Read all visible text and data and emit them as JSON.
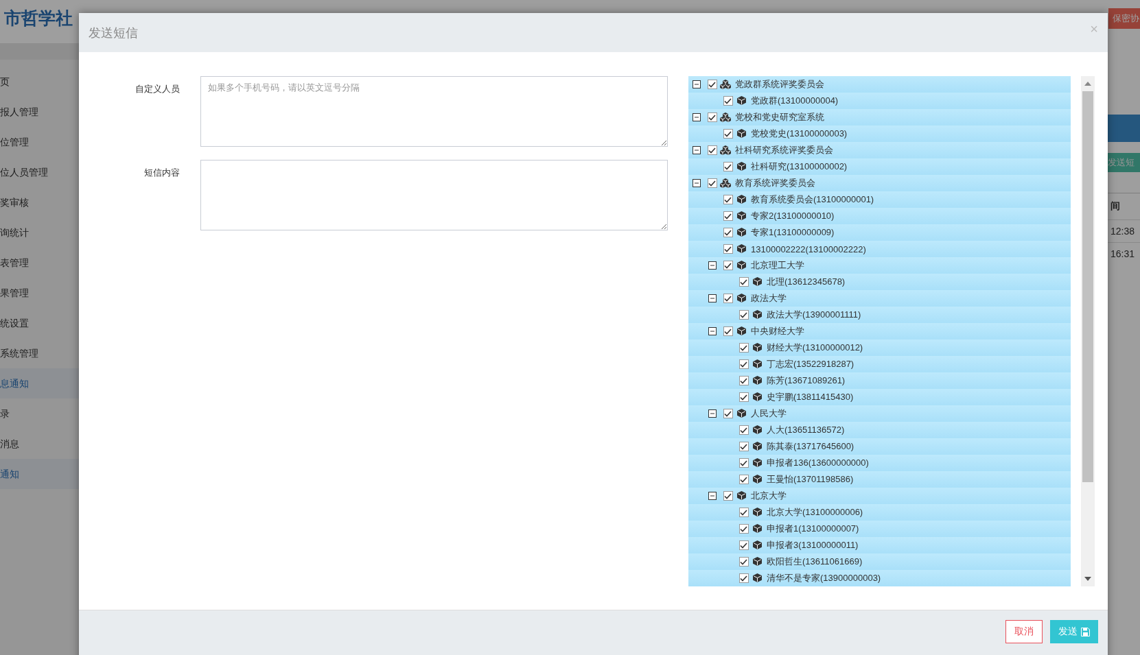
{
  "background_page": {
    "site_title": "市哲学社",
    "sidebar": {
      "items": [
        {
          "label": "页",
          "selected": false
        },
        {
          "label": "报人管理",
          "selected": false
        },
        {
          "label": "位管理",
          "selected": false
        },
        {
          "label": "位人员管理",
          "selected": false
        },
        {
          "label": "奖审核",
          "selected": false
        },
        {
          "label": "询统计",
          "selected": false
        },
        {
          "label": "表管理",
          "selected": false
        },
        {
          "label": "果管理",
          "selected": false
        },
        {
          "label": "统设置",
          "selected": false
        },
        {
          "label": "系统管理",
          "selected": false
        },
        {
          "label": "息通知",
          "selected": true
        },
        {
          "label": "录",
          "selected": false
        },
        {
          "label": "消息",
          "selected": false
        },
        {
          "label": "通知",
          "selected": true
        }
      ]
    },
    "top_button": "保密协",
    "send_button": "发送短",
    "table": {
      "column_1": "间",
      "rows": [
        "12:38",
        "16:31"
      ]
    }
  },
  "dialog": {
    "title": "发送短信",
    "close": "×",
    "fields": [
      {
        "label": "自定义人员",
        "placeholder": "如果多个手机号码，请以英文逗号分隔"
      },
      {
        "label": "短信内容"
      }
    ],
    "tree": [
      {
        "label": "党政群系统评奖委员会",
        "checked": true,
        "expanded": true,
        "children": [
          {
            "label": "党政群(13100000004)",
            "checked": true
          }
        ]
      },
      {
        "label": "党校和党史研究室系统",
        "checked": true,
        "expanded": true,
        "children": [
          {
            "label": "党校党史(13100000003)",
            "checked": true
          }
        ]
      },
      {
        "label": "社科研究系统评奖委员会",
        "checked": true,
        "expanded": true,
        "children": [
          {
            "label": "社科研究(13100000002)",
            "checked": true
          }
        ]
      },
      {
        "label": "教育系统评奖委员会",
        "checked": true,
        "expanded": true,
        "children": [
          {
            "label": "教育系统委员会(13100000001)",
            "checked": true
          },
          {
            "label": "专家2(13100000010)",
            "checked": true
          },
          {
            "label": "专家1(13100000009)",
            "checked": true
          },
          {
            "label": "13100002222(13100002222)",
            "checked": true
          },
          {
            "label": "北京理工大学",
            "checked": true,
            "expanded": true,
            "children": [
              {
                "label": "北理(13612345678)",
                "checked": true
              }
            ]
          },
          {
            "label": "政法大学",
            "checked": true,
            "expanded": true,
            "children": [
              {
                "label": "政法大学(13900001111)",
                "checked": true
              }
            ]
          },
          {
            "label": "中央财经大学",
            "checked": true,
            "expanded": true,
            "children": [
              {
                "label": "财经大学(13100000012)",
                "checked": true
              },
              {
                "label": "丁志宏(13522918287)",
                "checked": true
              },
              {
                "label": "陈芳(13671089261)",
                "checked": true
              },
              {
                "label": "史宇鹏(13811415430)",
                "checked": true
              }
            ]
          },
          {
            "label": "人民大学",
            "checked": true,
            "expanded": true,
            "children": [
              {
                "label": "人大(13651136572)",
                "checked": true
              },
              {
                "label": "陈其泰(13717645600)",
                "checked": true
              },
              {
                "label": "申报者136(13600000000)",
                "checked": true
              },
              {
                "label": "王曼怡(13701198586)",
                "checked": true
              }
            ]
          },
          {
            "label": "北京大学",
            "checked": true,
            "expanded": true,
            "children": [
              {
                "label": "北京大学(13100000006)",
                "checked": true
              },
              {
                "label": "申报者1(13100000007)",
                "checked": true
              },
              {
                "label": "申报者3(13100000011)",
                "checked": true
              },
              {
                "label": "欧阳哲生(13611061669)",
                "checked": true
              },
              {
                "label": "清华不是专家(13900000003)",
                "checked": true
              }
            ]
          }
        ]
      }
    ],
    "buttons": [
      {
        "label": "取消",
        "kind": "cancel"
      },
      {
        "label": "发送",
        "kind": "send"
      }
    ]
  }
}
